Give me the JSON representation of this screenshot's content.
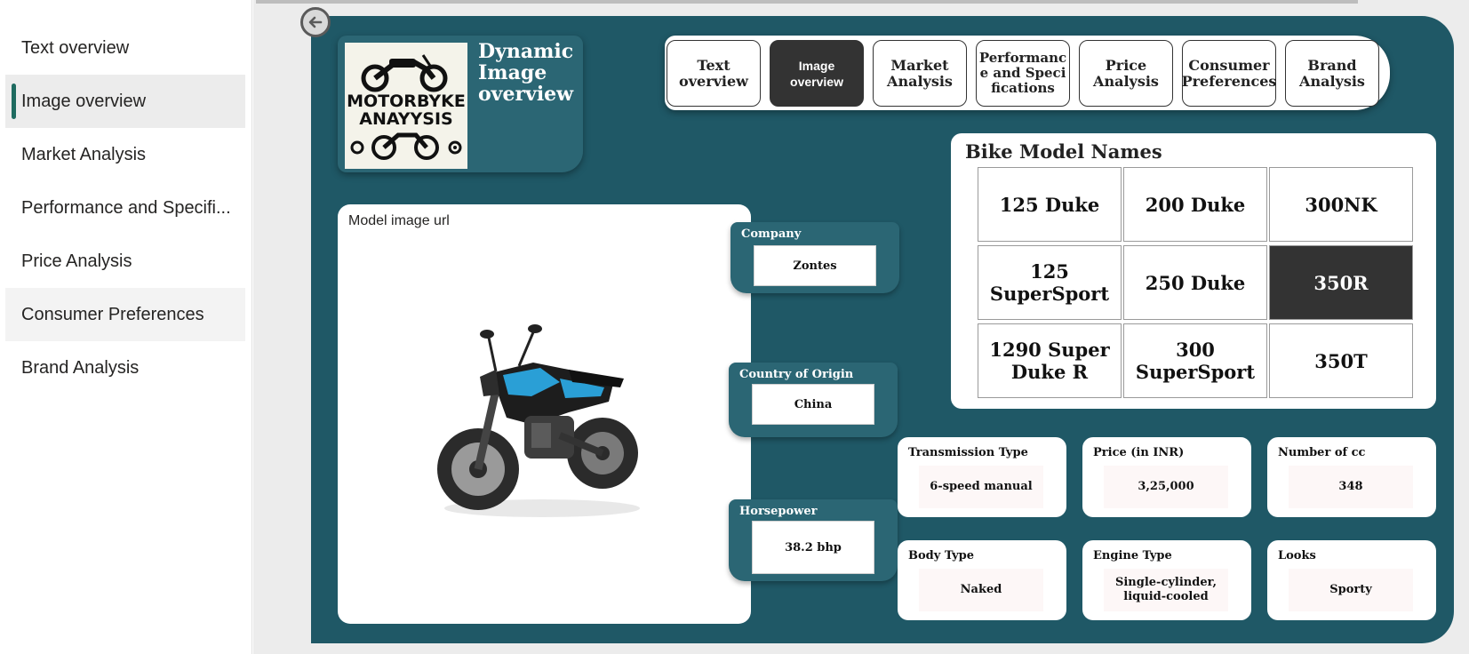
{
  "nav": {
    "items": [
      {
        "label": "Text overview"
      },
      {
        "label": "Image overview"
      },
      {
        "label": "Market Analysis"
      },
      {
        "label": "Performance and Specifi..."
      },
      {
        "label": "Price Analysis"
      },
      {
        "label": "Consumer Preferences"
      },
      {
        "label": "Brand Analysis"
      }
    ],
    "active_index": 1
  },
  "header": {
    "logo_text": "MOTORBYKE ANAYYSIS",
    "title": "Dynamic Image overview"
  },
  "tabs": [
    {
      "label": "Text overview"
    },
    {
      "label": "Image overview"
    },
    {
      "label": "Market Analysis"
    },
    {
      "label": "Performance and Specifications"
    },
    {
      "label": "Price Analysis"
    },
    {
      "label": "Consumer Preferences"
    },
    {
      "label": "Brand Analysis"
    }
  ],
  "image_card": {
    "title": "Model image url"
  },
  "fields": {
    "company": {
      "label": "Company",
      "value": "Zontes"
    },
    "country": {
      "label": "Country of Origin",
      "value": "China"
    },
    "horsepower": {
      "label": "Horsepower",
      "value": "38.2 bhp"
    }
  },
  "models": {
    "title": "Bike Model Names",
    "items": [
      {
        "label": "125 Duke"
      },
      {
        "label": "200 Duke"
      },
      {
        "label": "300NK"
      },
      {
        "label": "125 SuperSport"
      },
      {
        "label": "250 Duke"
      },
      {
        "label": "350R"
      },
      {
        "label": "1290 Super Duke R"
      },
      {
        "label": "300 SuperSport"
      },
      {
        "label": "350T"
      }
    ],
    "selected": "350R"
  },
  "info": {
    "transmission": {
      "label": "Transmission Type",
      "value": "6-speed manual"
    },
    "price": {
      "label": "Price (in INR)",
      "value": "3,25,000"
    },
    "cc": {
      "label": "Number of cc",
      "value": "348"
    },
    "body": {
      "label": "Body Type",
      "value": "Naked"
    },
    "engine": {
      "label": "Engine Type",
      "value": "Single-cylinder, liquid-cooled"
    },
    "looks": {
      "label": "Looks",
      "value": "Sporty"
    }
  },
  "colors": {
    "page_bg": "#1f5866",
    "card_accent": "#2b6674",
    "selected_dark": "#333333",
    "nav_indicator": "#1e6b60",
    "bike_accent": "#2a9fd6"
  },
  "icons": {
    "back": "back-arrow-icon",
    "next_page": "chevron-right-icon"
  }
}
